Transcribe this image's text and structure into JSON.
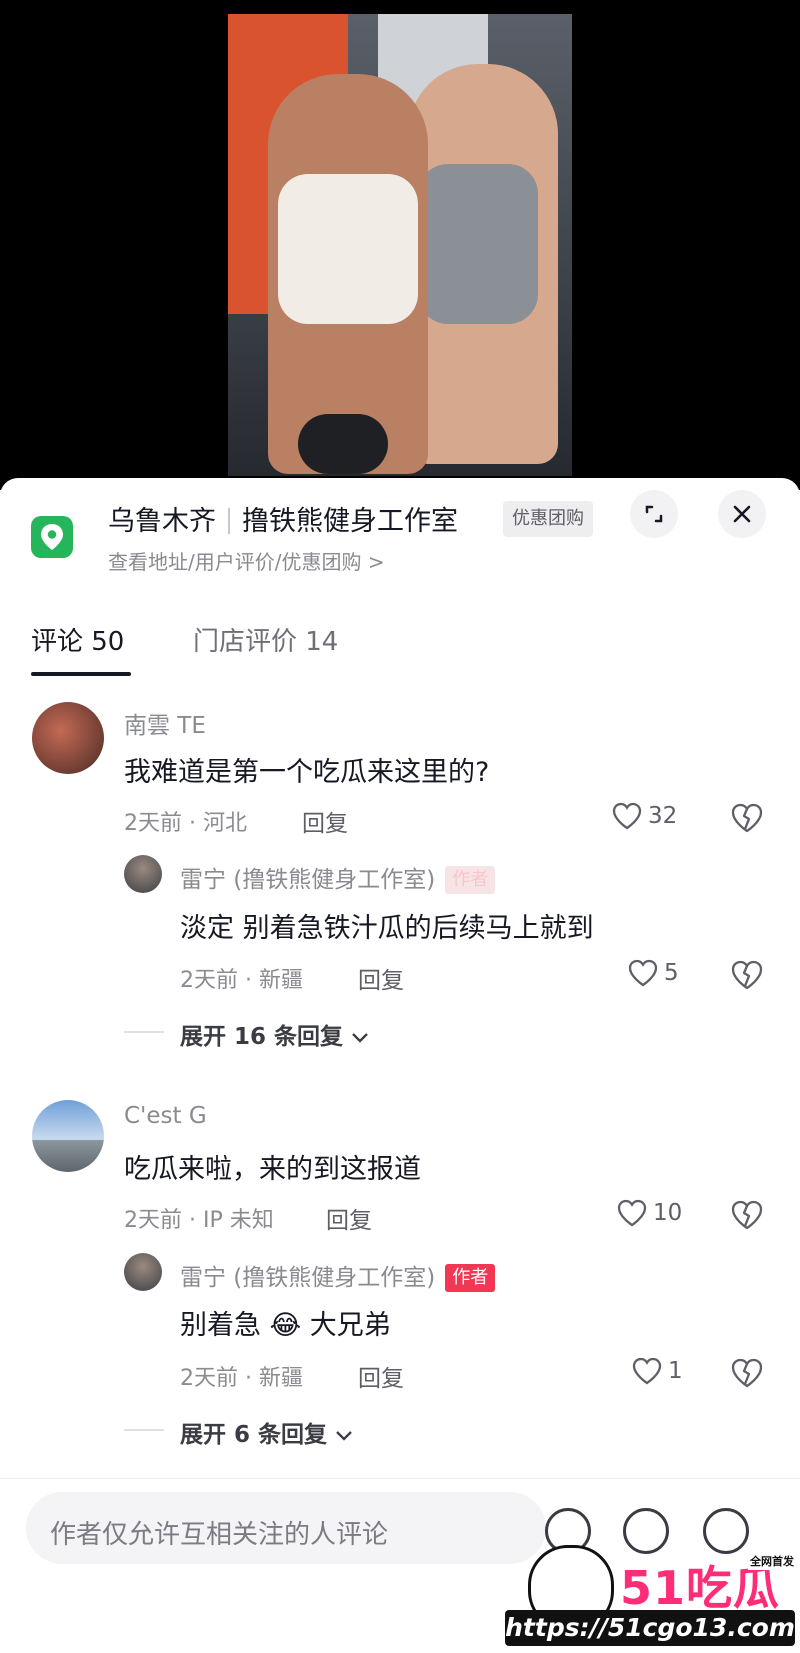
{
  "shop": {
    "city": "乌鲁木齐",
    "name": "撸铁熊健身工作室",
    "promo_tag": "优惠团购",
    "subtitle": "查看地址/用户评价/优惠团购 >"
  },
  "tabs": [
    {
      "label": "评论 50",
      "active": true
    },
    {
      "label": "门店评价 14",
      "active": false
    }
  ],
  "comments": [
    {
      "user": "南雲 TE",
      "text": "我难道是第一个吃瓜来这里的?",
      "meta": "2天前 · 河北",
      "reply_label": "回复",
      "likes": "32",
      "reply": {
        "user": "雷宁 (撸铁熊健身工作室)",
        "badge": "作者",
        "text": "淡定 别着急铁汁瓜的后续马上就到",
        "meta": "2天前 · 新疆",
        "reply_label": "回复",
        "likes": "5"
      },
      "expand": "展开 16 条回复"
    },
    {
      "user": "C'est G",
      "text": "吃瓜来啦，来的到这报道",
      "meta": "2天前 · IP 未知",
      "reply_label": "回复",
      "likes": "10",
      "reply": {
        "user": "雷宁 (撸铁熊健身工作室)",
        "badge": "作者",
        "text": "别着急 😂 大兄弟",
        "meta": "2天前 · 新疆",
        "reply_label": "回复",
        "likes": "1"
      },
      "expand": "展开 6 条回复"
    }
  ],
  "bottom": {
    "input_placeholder": "作者仅允许互相关注的人评论"
  },
  "watermark": {
    "logo": "51吃瓜",
    "tag": "全网首发",
    "url": "https://51cgo13.com"
  },
  "colors": {
    "accent_author": "#f23755",
    "location_green": "#25b65b"
  }
}
